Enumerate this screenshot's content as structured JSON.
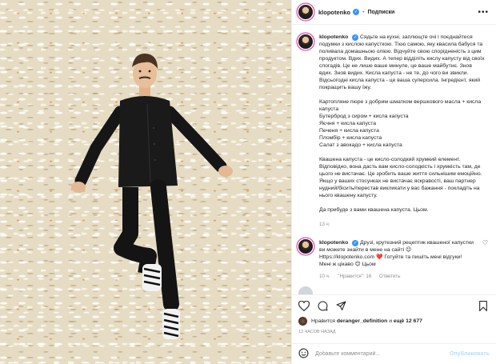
{
  "header": {
    "username": "klopotenko",
    "verified_mark": "✓",
    "separator": "•",
    "follow_label": "Подписки",
    "more_label": "•••"
  },
  "caption": {
    "username": "klopotenko",
    "p1": [
      "Сядьте на кухні, заплющте очі і поєднайтеся",
      "подумки з кислою капусткою. Тією самою, яку квасила бабуся та",
      "поливала домашньою олією. Відчуйте свою спорідненість з цим",
      "продуктом. Вдих. Видих. А тепер відділіть кислу капусту від своїх",
      "спогадів. Це не лише ваше минуле, це ваше майбутнє. Знов",
      "вдих. Знов видих. Кисла капуста - не те, до чого ви звикли.",
      "Відсьогодні кисла капуста - це ваша суперсила. Інгредієнт, який",
      "покращить вашу їжу."
    ],
    "p2": [
      "Картопляне пюре з добрим шматком вершкового масла + кисла",
      "капуста",
      "Бутерброд з сиром + кисла капуста",
      "Яєчня + кисла капуста",
      "Печеня + кисла капуста",
      "Пломбір + кисла капуста",
      "Салат з авокадо + кисла капуста"
    ],
    "p3": [
      "Квашена капуста - це кисло-солодкий хрумкий елемент.",
      "Відповідно, вона дасть вам кисло-солодкість і хрумкість там, де",
      "цього не вистачає. Це зробить ваше життя сильнішим емоційно.",
      "Якщо у ваших стосунках не вистачає яскравості, ваш партнер",
      "нудний/бісить/перестав викликати у вас бажання - покладіть на",
      "нього квашену капусту."
    ],
    "p4": "Да прибуде з вами квашена капуста. Цьом.",
    "time": "13 ч."
  },
  "comment": {
    "username": "klopotenko",
    "lines": [
      "Друзі, крутезний рецептик квашеної капустки",
      "ви можете знайти в мене на сайті 😉",
      "Https://klopotenko.com ❤️ Готуйте та пишіть мені відгуки!",
      "Мені ж цікаво 😊 Цьом"
    ],
    "time": "10 ч.",
    "likes": "\"Нравится\": 16",
    "reply": "Ответить",
    "heart": "♡"
  },
  "actions": {
    "like_icon": "heart-icon",
    "comment_icon": "comment-icon",
    "share_icon": "share-icon",
    "save_icon": "bookmark-icon"
  },
  "likes": {
    "prefix": "Нравится",
    "user": "deranger_definition",
    "middle": "и",
    "count": "ещё 12 677"
  },
  "timestamp": "13 ЧАСОВ НАЗАД",
  "add_comment": {
    "placeholder": "Добавьте комментарий...",
    "publish": "Опубликовать",
    "emoji_icon": "emoji-icon"
  }
}
